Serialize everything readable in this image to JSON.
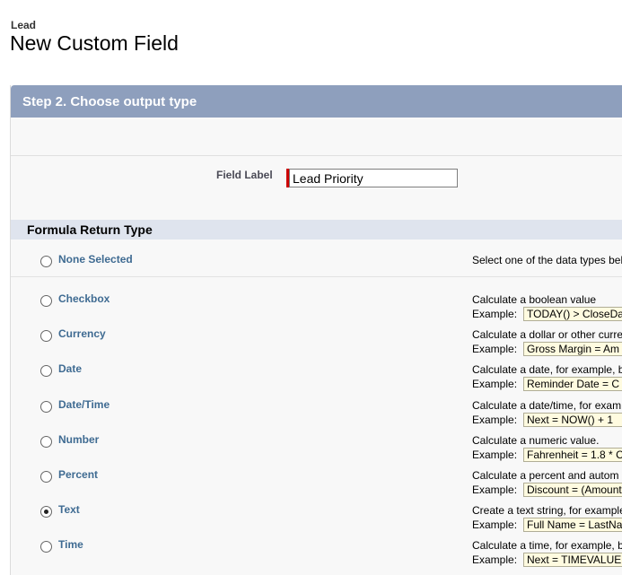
{
  "header": {
    "object_name": "Lead",
    "title": "New Custom Field"
  },
  "step": {
    "title": "Step 2. Choose output type"
  },
  "field_label": {
    "label": "Field Label",
    "value": "Lead Priority"
  },
  "formula_return_type": {
    "heading": "Formula Return Type",
    "none_selected": {
      "label": "None Selected",
      "description": "Select one of the data types bel"
    },
    "example_label": "Example:",
    "types": [
      {
        "label": "Checkbox",
        "description": "Calculate a boolean value",
        "example": "TODAY() > CloseDa",
        "selected": false
      },
      {
        "label": "Currency",
        "description": "Calculate a dollar or other curre",
        "example": "Gross Margin = Am",
        "selected": false
      },
      {
        "label": "Date",
        "description": "Calculate a date, for example, b",
        "example": "Reminder Date = C",
        "selected": false
      },
      {
        "label": "Date/Time",
        "description": "Calculate a date/time, for exam",
        "example": "Next = NOW() + 1",
        "selected": false
      },
      {
        "label": "Number",
        "description": "Calculate a numeric value.",
        "example": "Fahrenheit = 1.8 * C",
        "selected": false
      },
      {
        "label": "Percent",
        "description": "Calculate a percent and autom",
        "example": "Discount = (Amount",
        "selected": false
      },
      {
        "label": "Text",
        "description": "Create a text string, for example",
        "example": "Full Name = LastNa",
        "selected": true
      },
      {
        "label": "Time",
        "description": "Calculate a time, for example, b",
        "example": "Next = TIMEVALUE(",
        "selected": false
      }
    ]
  }
}
